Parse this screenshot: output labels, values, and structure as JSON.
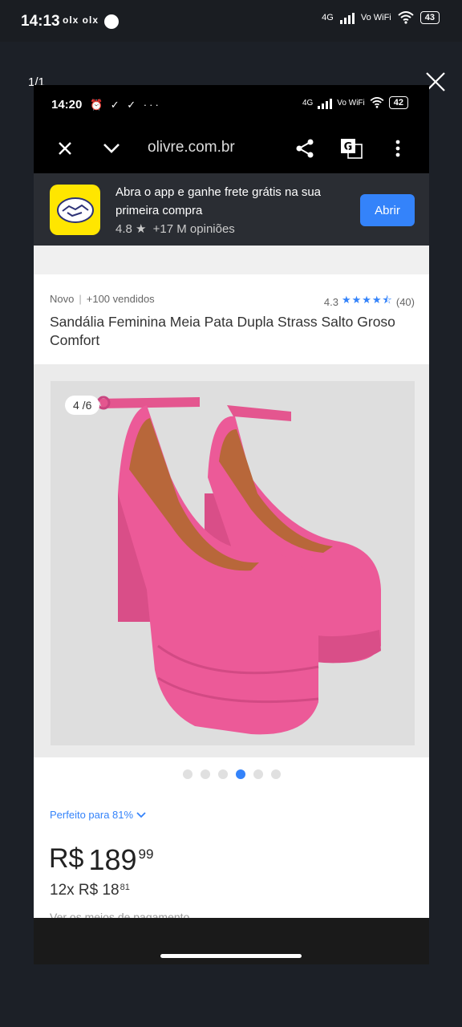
{
  "outer_status": {
    "time": "14:13",
    "notifications": "olx olx",
    "network": "4G",
    "wifi_label": "Vo WiFi",
    "battery": "43"
  },
  "viewer": {
    "counter": "1/1"
  },
  "inner_status": {
    "time": "14:20",
    "icons": "⏰ ✓ ✓ ···",
    "network": "4G",
    "wifi_label": "Vo WiFi",
    "battery": "42"
  },
  "browser": {
    "url": "olivre.com.br"
  },
  "app_banner": {
    "text": "Abra o app e ganhe frete grátis na sua primeira compra",
    "rating": "4.8",
    "reviews": "+17 M opiniões",
    "open_label": "Abrir"
  },
  "product": {
    "condition": "Novo",
    "sold": "+100 vendidos",
    "rating": "4.3",
    "rating_value": 4.5,
    "review_count": "(40)",
    "title": "Sandália Feminina Meia Pata Dupla Strass Salto Groso Comfort",
    "image_counter": "4 /6",
    "image_total": 6,
    "image_active": 4,
    "fit_label": "Perfeito para 81%",
    "price_currency": "R$",
    "price_int": "189",
    "price_cents": "99",
    "installment": "12x R$ 18",
    "installment_cents": "81",
    "payment_link": "Ver os meios de pagamento"
  },
  "colors": {
    "accent": "#3483fa",
    "banner": "#2a2d33",
    "shoe": "#ec5a98",
    "logo": "#ffe600"
  }
}
